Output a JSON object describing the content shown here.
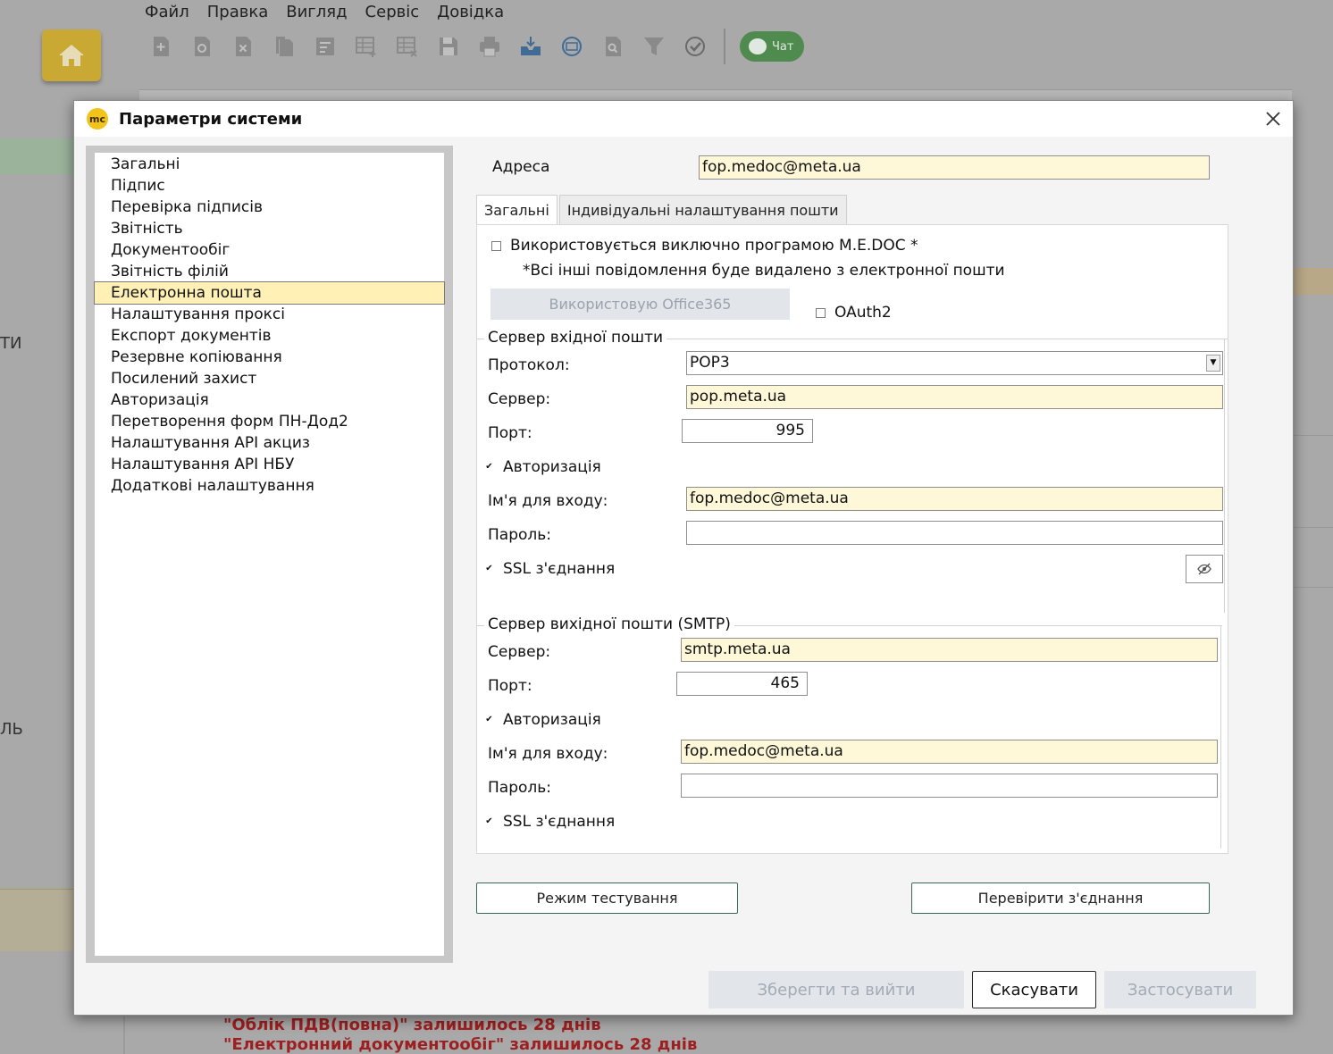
{
  "background": {
    "menu": [
      "Файл",
      "Правка",
      "Вигляд",
      "Сервіс",
      "Довідка"
    ],
    "chat_label": "Чат",
    "side_text_1": "ТИ",
    "side_text_2": "ЛЬ",
    "warnings": [
      "\"Облік ПДВ(повна)\" залишилось 28 днів",
      "\"Електронний документообіг\" залишилось 28 днів"
    ]
  },
  "dialog": {
    "logo": "mc",
    "title": "Параметри системи"
  },
  "nav": {
    "active_index": 6,
    "items": [
      "Загальні",
      "Підпис",
      "Перевірка підписів",
      "Звітність",
      "Документообіг",
      "Звітність філій",
      "Електронна пошта",
      "Налаштування проксі",
      "Експорт документів",
      "Резервне копіювання",
      "Посилений захист",
      "Авторизація",
      "Перетворення форм ПН-Дод2",
      "Налаштування API акциз",
      "Налаштування API НБУ",
      "Додаткові налаштування"
    ]
  },
  "email": {
    "address_label": "Адреса",
    "address_value": "fop.medoc@meta.ua",
    "tabs": [
      "Загальні",
      "Індивідуальні налаштування пошти"
    ],
    "exclusive_label": "Використовується виключно програмою M.E.DOC *",
    "exclusive_checked": false,
    "exclusive_note": "*Всі інші повідомлення буде видалено з електронної пошти",
    "office365_label": "Використовую Office365",
    "oauth2_label": "OAuth2",
    "oauth2_checked": false,
    "incoming": {
      "title": "Сервер вхідної пошти",
      "protocol_label": "Протокол:",
      "protocol_value": "POP3",
      "server_label": "Сервер:",
      "server_value": "pop.meta.ua",
      "port_label": "Порт:",
      "port_value": "995",
      "auth_label": "Авторизація",
      "auth_checked": true,
      "login_label": "Ім'я для входу:",
      "login_value": "fop.medoc@meta.ua",
      "password_label": "Пароль:",
      "password_value": "",
      "ssl_label": "SSL з'єднання",
      "ssl_checked": true
    },
    "outgoing": {
      "title": "Сервер вихідної пошти (SMTP)",
      "server_label": "Сервер:",
      "server_value": "smtp.meta.ua",
      "port_label": "Порт:",
      "port_value": "465",
      "auth_label": "Авторизація",
      "auth_checked": true,
      "login_label": "Ім'я для входу:",
      "login_value": "fop.medoc@meta.ua",
      "password_label": "Пароль:",
      "password_value": "",
      "ssl_label": "SSL з'єднання",
      "ssl_checked": true
    },
    "test_mode_label": "Режим тестування",
    "check_connection_label": "Перевірити з'єднання"
  },
  "footer": {
    "save_exit": "Зберегти та вийти",
    "cancel": "Скасувати",
    "apply": "Застосувати"
  }
}
